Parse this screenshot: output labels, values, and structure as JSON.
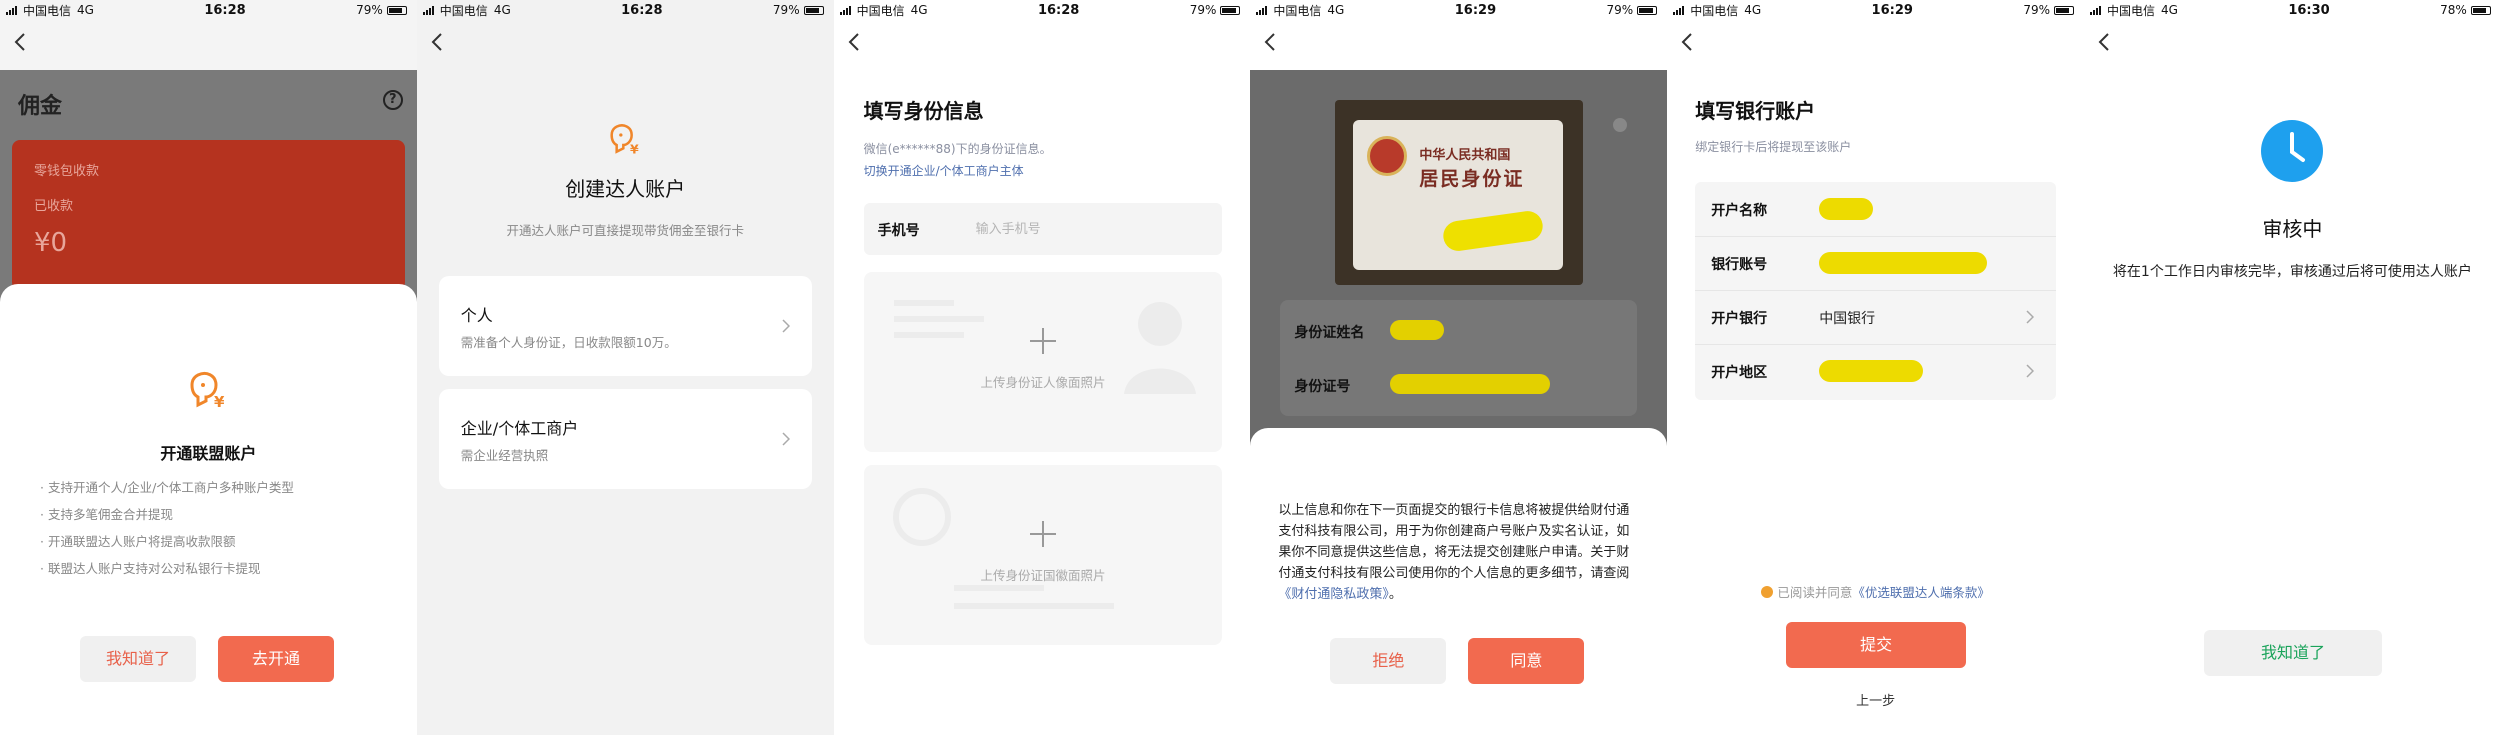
{
  "status_bars": [
    {
      "carrier": "中国电信",
      "network": "4G",
      "time": "16:28",
      "battery": "79%"
    },
    {
      "carrier": "中国电信",
      "network": "4G",
      "time": "16:28",
      "battery": "79%"
    },
    {
      "carrier": "中国电信",
      "network": "4G",
      "time": "16:28",
      "battery": "79%"
    },
    {
      "carrier": "中国电信",
      "network": "4G",
      "time": "16:29",
      "battery": "79%"
    },
    {
      "carrier": "中国电信",
      "network": "4G",
      "time": "16:29",
      "battery": "79%"
    },
    {
      "carrier": "中国电信",
      "network": "4G",
      "time": "16:30",
      "battery": "78%"
    }
  ],
  "screen1": {
    "page_title": "佣金",
    "help_icon": "question-icon",
    "card": {
      "label1": "零钱包收款",
      "label2": "已收款",
      "amount": "¥0"
    },
    "sheet": {
      "title": "开通联盟账户",
      "bullets": [
        "· 支持开通个人/企业/个体工商户多种账户类型",
        "· 支持多笔佣金合并提现",
        "· 开通联盟达人账户将提高收款限额",
        "· 联盟达人账户支持对公对私银行卡提现"
      ],
      "cancel_label": "我知道了",
      "confirm_label": "去开通"
    }
  },
  "screen2": {
    "title": "创建达人账户",
    "subtitle": "开通达人账户可直接提现带货佣金至银行卡",
    "options": [
      {
        "title": "个人",
        "desc": "需准备个人身份证，日收款限额10万。"
      },
      {
        "title": "企业/个体工商户",
        "desc": "需企业经营执照"
      }
    ]
  },
  "screen3": {
    "title": "填写身份信息",
    "subtitle": "微信(e******88)下的身份证信息。",
    "switch_link": "切换开通企业/个体工商户主体",
    "phone_label": "手机号",
    "phone_placeholder": "输入手机号",
    "upload_front": "上传身份证人像面照片",
    "upload_back": "上传身份证国徽面照片"
  },
  "screen4": {
    "id_card_line1": "中华人民共和国",
    "id_card_line2": "居民身份证",
    "name_label": "身份证姓名",
    "number_label": "身份证号",
    "consent_text": "以上信息和你在下一页面提交的银行卡信息将被提供给财付通支付科技有限公司，用于为你创建商户号账户及实名认证，如果你不同意提供这些信息，将无法提交创建账户申请。关于财付通支付科技有限公司使用你的个人信息的更多细节，请查阅",
    "policy_link": "《财付通隐私政策》",
    "period": "。",
    "reject_label": "拒绝",
    "agree_label": "同意"
  },
  "screen5": {
    "title": "填写银行账户",
    "subtitle": "绑定银行卡后将提现至该账户",
    "rows": [
      {
        "label": "开户名称",
        "value": ""
      },
      {
        "label": "银行账号",
        "value": ""
      },
      {
        "label": "开户银行",
        "value": "中国银行"
      },
      {
        "label": "开户地区",
        "value": ""
      }
    ],
    "agree_prefix": "已阅读并同意",
    "agree_link": "《优选联盟达人端条款》",
    "submit_label": "提交",
    "prev_label": "上一步"
  },
  "screen6": {
    "title": "审核中",
    "desc": "将在1个工作日内审核完毕，审核通过后将可使用达人账户",
    "ok_label": "我知道了"
  },
  "colors": {
    "accent": "#f26a4f",
    "link": "#4f6fae",
    "success": "#1aa35a",
    "clock": "#1ea0ee"
  }
}
